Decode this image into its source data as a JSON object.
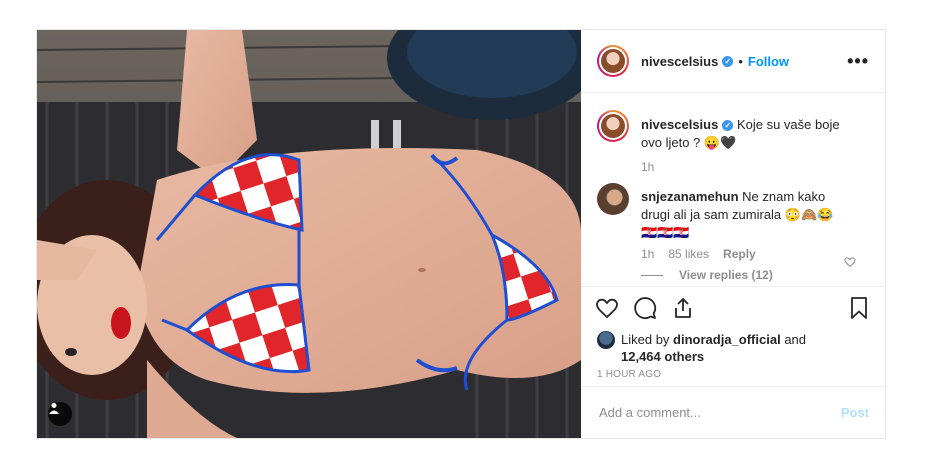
{
  "post": {
    "author": "nivescelsius",
    "follow_label": "Follow",
    "header_separator": "•",
    "more_label": "•••",
    "caption_text": "Koje su vaše boje ovo ljeto ? 😛🖤",
    "caption_time": "1h"
  },
  "comment": {
    "username": "snjezanamehun",
    "text": "Ne znam kako drugi ali ja sam zumirala 😳🙈😂🇭🇷🇭🇷🇭🇷",
    "time": "1h",
    "likes": "85 likes",
    "reply_label": "Reply",
    "view_replies": "View replies (12)"
  },
  "likes": {
    "prefix": "Liked by",
    "user": "dinoradja_official",
    "joiner": "and",
    "others": "12,464 others"
  },
  "posted_ago": "1 HOUR AGO",
  "add_comment": {
    "placeholder": "Add a comment...",
    "post_label": "Post"
  },
  "colors": {
    "follow_blue": "#0095f6",
    "verified_blue": "#3897f0",
    "post_disabled": "#b2dffc",
    "bikini_red": "#e0262b",
    "strap_blue": "#1f4fd1"
  },
  "icons": {
    "tag": "user-tag-icon",
    "heart": "heart-icon",
    "comment": "comment-icon",
    "share": "share-icon",
    "save": "bookmark-icon",
    "more": "more-options-icon",
    "verified": "verified-badge-icon"
  }
}
